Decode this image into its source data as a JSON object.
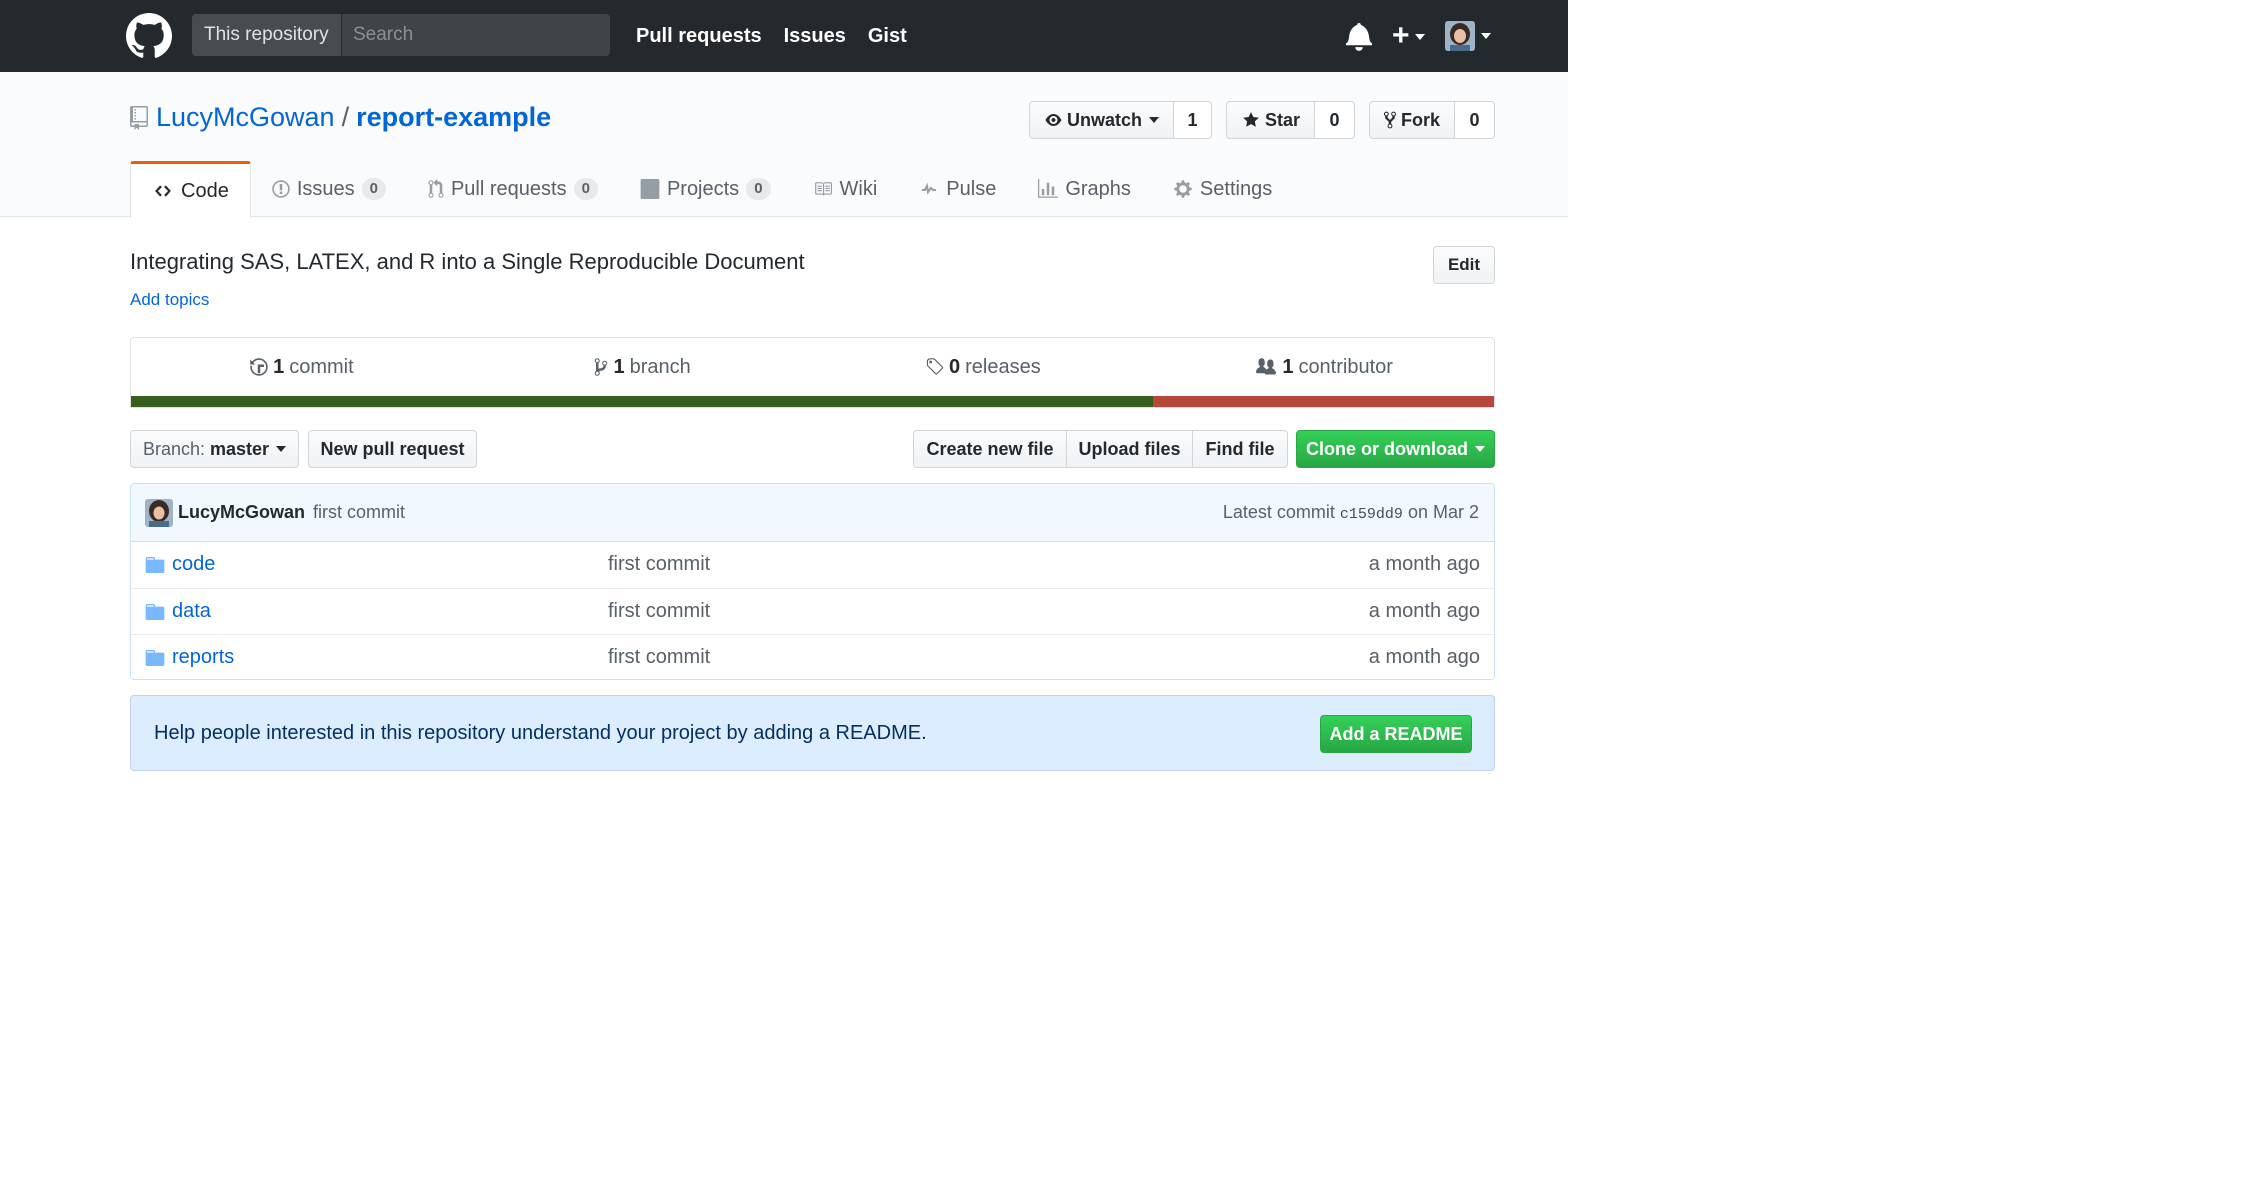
{
  "header": {
    "logo_icon": "github-octocat-icon",
    "search_scope": "This repository",
    "search_placeholder": "Search",
    "nav": [
      "Pull requests",
      "Issues",
      "Gist"
    ],
    "plus": "+"
  },
  "repo": {
    "owner": "LucyMcGowan",
    "separator": "/",
    "name": "report-example",
    "watch_label": "Unwatch",
    "watch_count": "1",
    "star_label": "Star",
    "star_count": "0",
    "fork_label": "Fork",
    "fork_count": "0"
  },
  "tabs": [
    {
      "label": "Code",
      "icon": "code-icon"
    },
    {
      "label": "Issues",
      "icon": "issue-icon",
      "count": "0"
    },
    {
      "label": "Pull requests",
      "icon": "pull-request-icon",
      "count": "0"
    },
    {
      "label": "Projects",
      "icon": "project-icon",
      "count": "0"
    },
    {
      "label": "Wiki",
      "icon": "book-icon"
    },
    {
      "label": "Pulse",
      "icon": "pulse-icon"
    },
    {
      "label": "Graphs",
      "icon": "graph-icon"
    },
    {
      "label": "Settings",
      "icon": "gear-icon"
    }
  ],
  "description": "Integrating SAS, LATEX, and R into a Single Reproducible Document",
  "add_topics": "Add topics",
  "edit_label": "Edit",
  "summary": {
    "commits": {
      "count": "1",
      "label": "commit"
    },
    "branches": {
      "count": "1",
      "label": "branch"
    },
    "releases": {
      "count": "0",
      "label": "releases"
    },
    "contributors": {
      "count": "1",
      "label": "contributor"
    }
  },
  "languages": [
    {
      "color": "#375f1f",
      "share": 0.75
    },
    {
      "color": "#b7473b",
      "share": 0.25
    }
  ],
  "branch": {
    "prefix": "Branch:",
    "name": "master"
  },
  "buttons": {
    "new_pr": "New pull request",
    "create_file": "Create new file",
    "upload": "Upload files",
    "find": "Find file",
    "clone": "Clone or download"
  },
  "latest_commit": {
    "author": "LucyMcGowan",
    "message": "first commit",
    "prefix": "Latest commit",
    "sha": "c159dd9",
    "date": "on Mar 2"
  },
  "files": [
    {
      "name": "code",
      "message": "first commit",
      "age": "a month ago"
    },
    {
      "name": "data",
      "message": "first commit",
      "age": "a month ago"
    },
    {
      "name": "reports",
      "message": "first commit",
      "age": "a month ago"
    }
  ],
  "readme_prompt": {
    "text": "Help people interested in this repository understand your project by adding a README.",
    "button": "Add a README"
  }
}
